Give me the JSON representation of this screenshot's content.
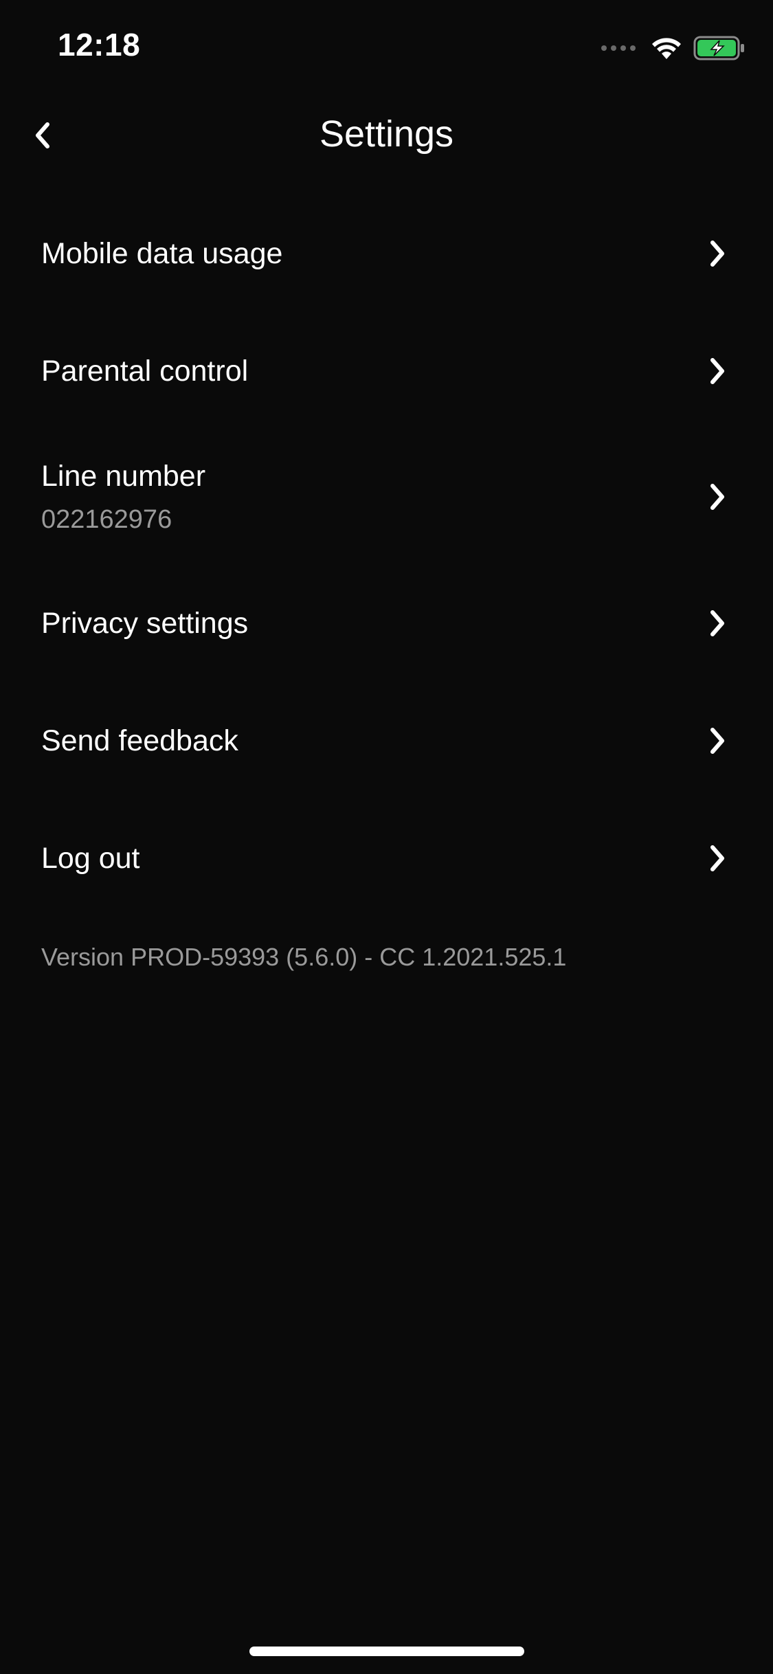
{
  "status_bar": {
    "time": "12:18",
    "icons": [
      "cellular-dots-icon",
      "wifi-icon",
      "battery-charging-icon"
    ]
  },
  "header": {
    "title": "Settings",
    "back_icon": "chevron-left-icon"
  },
  "items": [
    {
      "label": "Mobile data usage",
      "icon": "chevron-right-icon"
    },
    {
      "label": "Parental control",
      "icon": "chevron-right-icon"
    },
    {
      "label": "Line number",
      "sub": "022162976",
      "icon": "chevron-right-icon"
    },
    {
      "label": "Privacy settings",
      "icon": "chevron-right-icon"
    },
    {
      "label": "Send feedback",
      "icon": "chevron-right-icon"
    },
    {
      "label": "Log out",
      "icon": "chevron-right-icon"
    }
  ],
  "footer": {
    "version": "Version PROD-59393 (5.6.0) - CC 1.2021.525.1"
  },
  "colors": {
    "background": "#0a0a0a",
    "text": "#ffffff",
    "secondary_text": "#9a9a9a",
    "battery_fill": "#34c759"
  }
}
